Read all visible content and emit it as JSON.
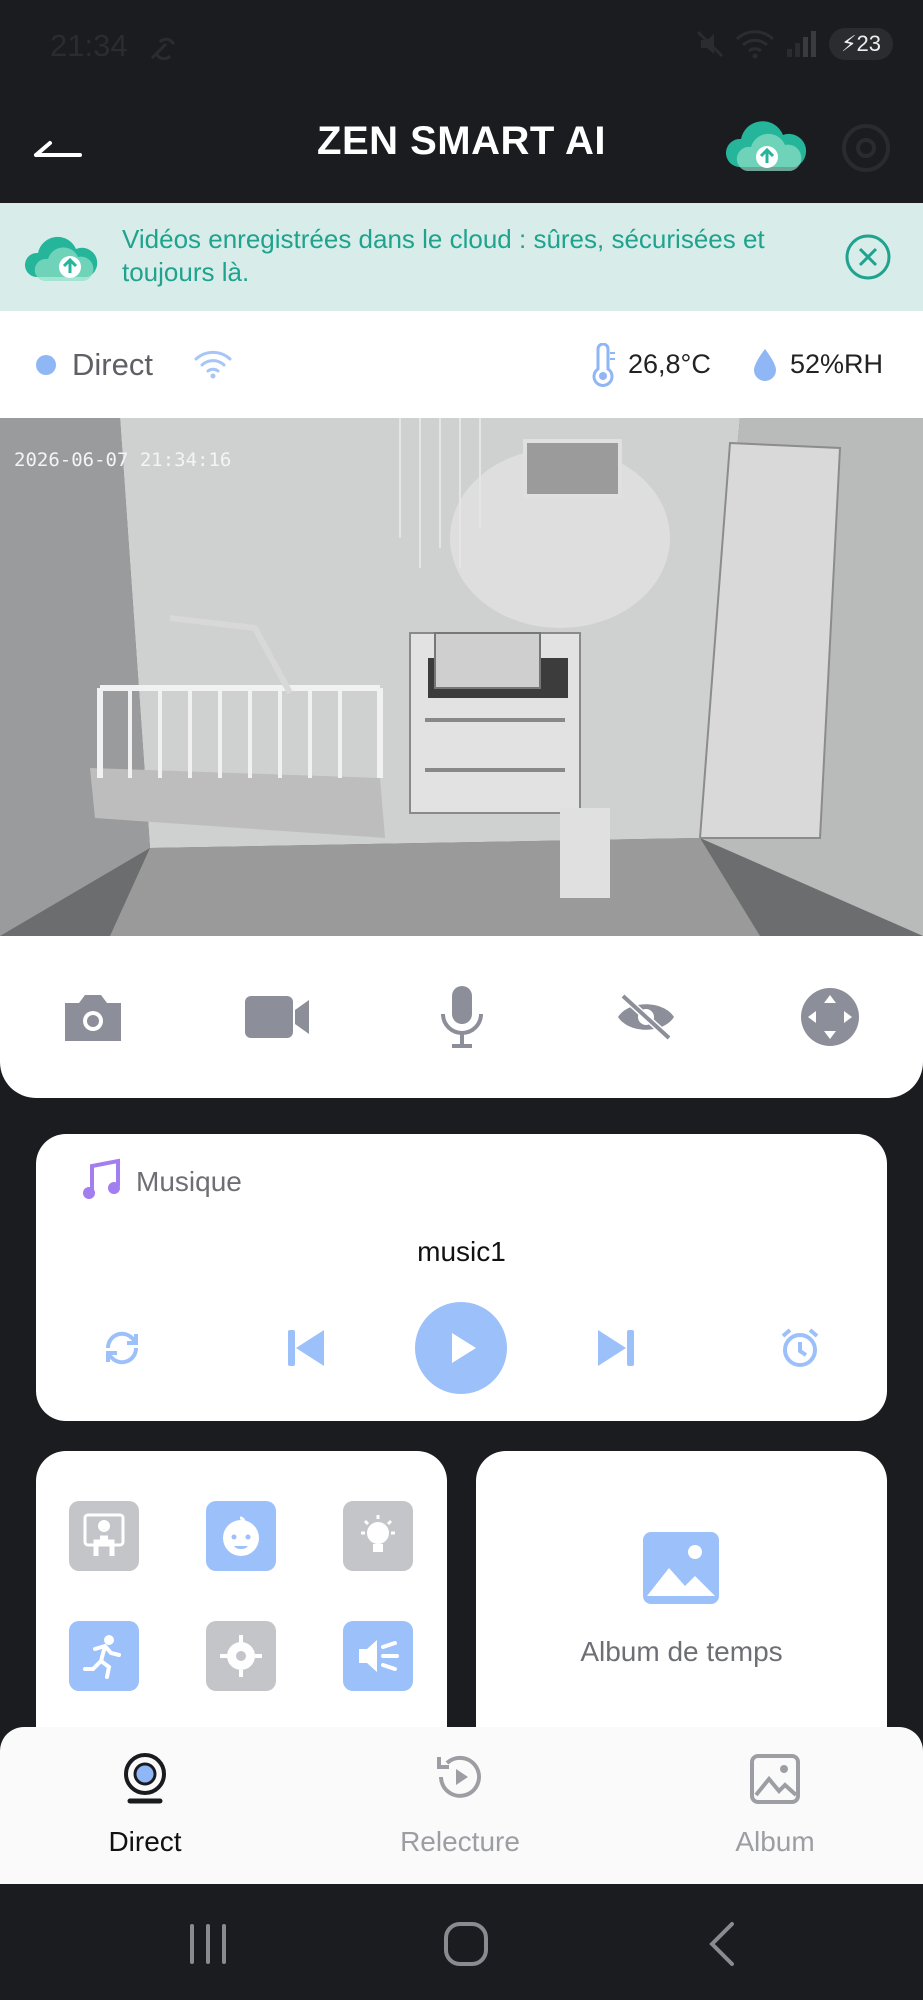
{
  "status_bar": {
    "time": "21:34",
    "battery": "23"
  },
  "app_bar": {
    "title": "ZEN SMART AI"
  },
  "banner": {
    "text": "Vidéos enregistrées dans le cloud : sûres, sécurisées et toujours là."
  },
  "info_row": {
    "live_label": "Direct",
    "temperature": "26,8°C",
    "humidity": "52%RH"
  },
  "video": {
    "timestamp": "2026-06-07 21:34:16"
  },
  "controls": [
    "camera-icon",
    "video-camera-icon",
    "microphone-icon",
    "eye-off-icon",
    "pan-tilt-icon"
  ],
  "music": {
    "label": "Musique",
    "track": "music1"
  },
  "features": [
    "person-frame-icon",
    "baby-face-icon",
    "lightbulb-icon",
    "running-person-icon",
    "crosshair-icon",
    "sound-detection-icon"
  ],
  "album_card": {
    "label": "Album de temps"
  },
  "bottom_nav": [
    {
      "label": "Direct",
      "active": true
    },
    {
      "label": "Relecture",
      "active": false
    },
    {
      "label": "Album",
      "active": false
    }
  ],
  "colors": {
    "accent": "#9cc0fa",
    "teal": "#1fa38f",
    "banner_bg": "#d8ede9",
    "dark": "#1b1c20"
  }
}
